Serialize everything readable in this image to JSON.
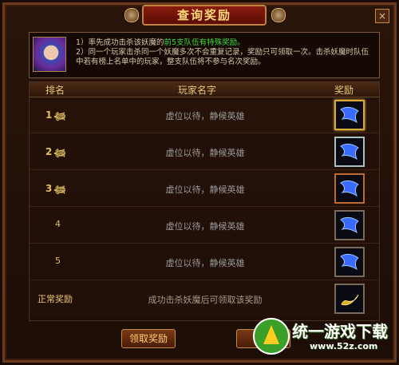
{
  "window": {
    "title": "查询奖励",
    "close_label": "×"
  },
  "info": {
    "line1_prefix": "1）率先成功击杀该妖魔的",
    "line1_highlight": "前5支队伍有特殊奖励。",
    "line2": "2）同一个玩家击杀同一个妖魔多次不会重复记录，奖励只可领取一次。击杀妖魔时队伍中若有榜上名单中的玩家，整支队伍将不参与名次奖励。"
  },
  "table": {
    "headers": {
      "rank": "排名",
      "player": "玩家名字",
      "reward": "奖励"
    },
    "rows": [
      {
        "rank": "1",
        "player": "虚位以待，静候英雄",
        "reward_icon": "blue-gem-icon",
        "frame": "gold"
      },
      {
        "rank": "2",
        "player": "虚位以待，静候英雄",
        "reward_icon": "blue-gem-icon",
        "frame": "silver"
      },
      {
        "rank": "3",
        "player": "虚位以待，静候英雄",
        "reward_icon": "blue-gem-icon",
        "frame": "bronze"
      },
      {
        "rank": "4",
        "player": "虚位以待，静候英雄",
        "reward_icon": "blue-gem-icon",
        "frame": "plain"
      },
      {
        "rank": "5",
        "player": "虚位以待，静候英雄",
        "reward_icon": "blue-gem-icon",
        "frame": "plain"
      },
      {
        "rank": "正常奖励",
        "player": "成功击杀妖魔后可领取该奖励",
        "reward_icon": "gold-crescent-icon",
        "frame": "plain"
      }
    ]
  },
  "buttons": {
    "claim": "领取奖励",
    "cancel": "取"
  },
  "watermark": {
    "text": "统一游戏下载",
    "url": "www.52z.com"
  },
  "colors": {
    "accent": "#ffd87a",
    "highlight": "#3cdc3c",
    "gem_blue": "#3a6aff",
    "frame_gold": "#d8a83a"
  }
}
